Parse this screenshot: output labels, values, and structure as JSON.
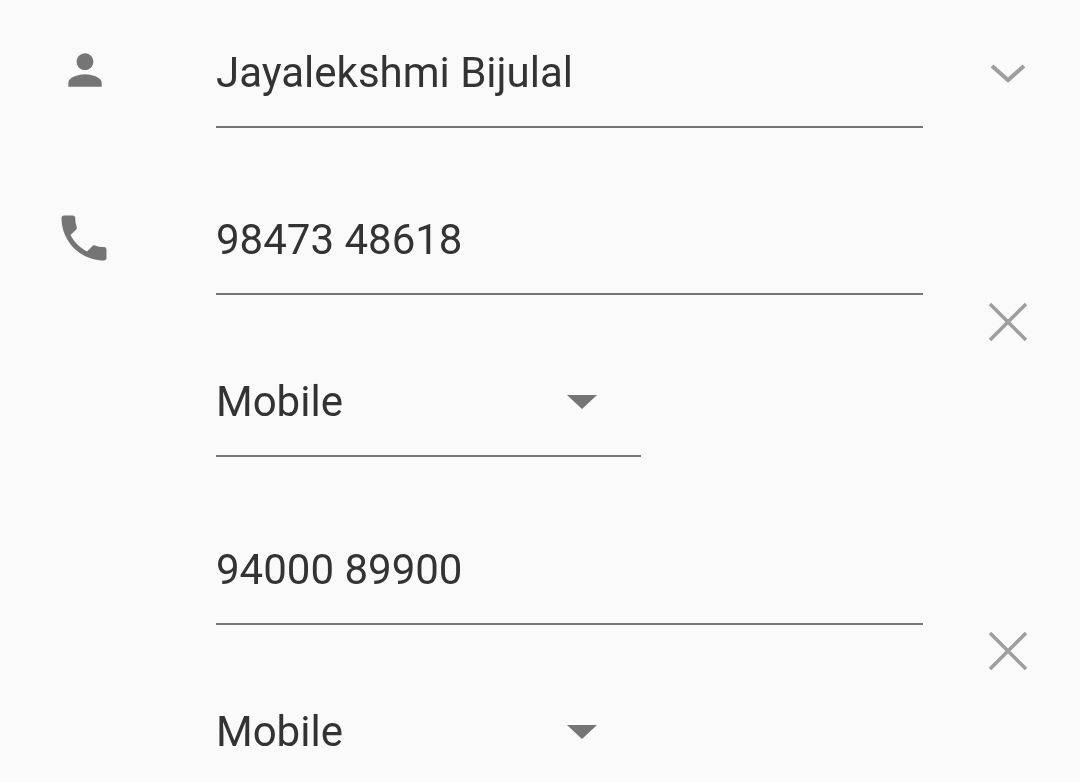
{
  "name_field": {
    "value": "Jayalekshmi Bijulal"
  },
  "phones": [
    {
      "number": "98473 48618",
      "type": "Mobile"
    },
    {
      "number": "94000 89900",
      "type": "Mobile"
    }
  ]
}
